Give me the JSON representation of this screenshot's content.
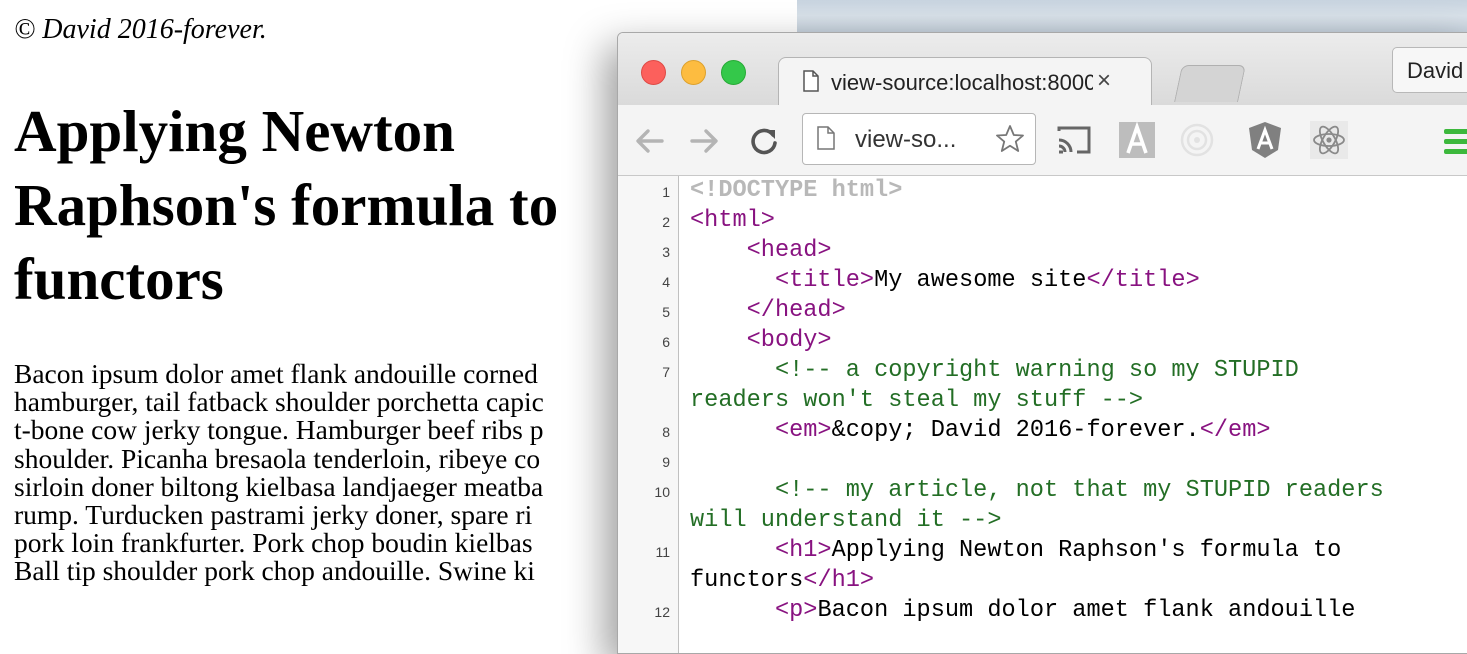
{
  "page": {
    "copyright": "© David 2016-forever.",
    "headline": "Applying Newton Raphson's formula to functors",
    "headline_lines": [
      "Applying Newton",
      "Raphson's formula to",
      "functors"
    ],
    "paragraph_lines": [
      "Bacon ipsum dolor amet flank andouille corned",
      "hamburger, tail fatback shoulder porchetta capic",
      "t-bone cow jerky tongue. Hamburger beef ribs p",
      "shoulder. Picanha bresaola tenderloin, ribeye co",
      "sirloin doner biltong kielbasa landjaeger meatba",
      "rump. Turducken pastrami jerky doner, spare ri",
      "pork loin frankfurter. Pork chop boudin kielbas",
      "Ball tip shoulder pork chop andouille. Swine ki"
    ]
  },
  "browser": {
    "tab_title": "view-source:localhost:8000",
    "tab_close": "×",
    "profile_name": "David",
    "omnibox_text": "view-so...",
    "icons": {
      "tab": "page-icon",
      "back": "back-arrow-icon",
      "forward": "forward-arrow-icon",
      "reload": "reload-icon",
      "star": "star-icon",
      "extensions": [
        "cast-icon",
        "a-extension-icon",
        "augury-icon",
        "angular-icon",
        "react-icon"
      ],
      "menu": "hamburger-menu-icon"
    },
    "colors": {
      "tag": "#881280",
      "comment": "#236e25",
      "doctype": "#b8b8b8",
      "traffic_red": "#fc605c",
      "traffic_yellow": "#fdbc40",
      "traffic_green": "#34c84a"
    }
  },
  "source": {
    "line_numbers": [
      "1",
      "2",
      "3",
      "4",
      "5",
      "6",
      "7",
      "8",
      "9",
      "10",
      "11",
      "12"
    ],
    "l1": "<!DOCTYPE html>",
    "l2": "<html>",
    "l3": "<head>",
    "l4_open": "<title>",
    "l4_text": "My awesome site",
    "l4_close": "</title>",
    "l5": "</head>",
    "l6": "<body>",
    "l7a": "<!-- a copyright warning so my STUPID",
    "l7b": "readers won't steal my stuff -->",
    "l8_open": "<em>",
    "l8_text": "&copy; David 2016-forever.",
    "l8_close": "</em>",
    "l10a": "<!-- my article, not that my STUPID readers",
    "l10b": "will understand it -->",
    "l11_open": "<h1>",
    "l11_text_a": "Applying Newton Raphson's formula to",
    "l11_text_b": "functors",
    "l11_close": "</h1>",
    "l12_open": "<p>",
    "l12_text": "Bacon ipsum dolor amet flank andouille"
  }
}
